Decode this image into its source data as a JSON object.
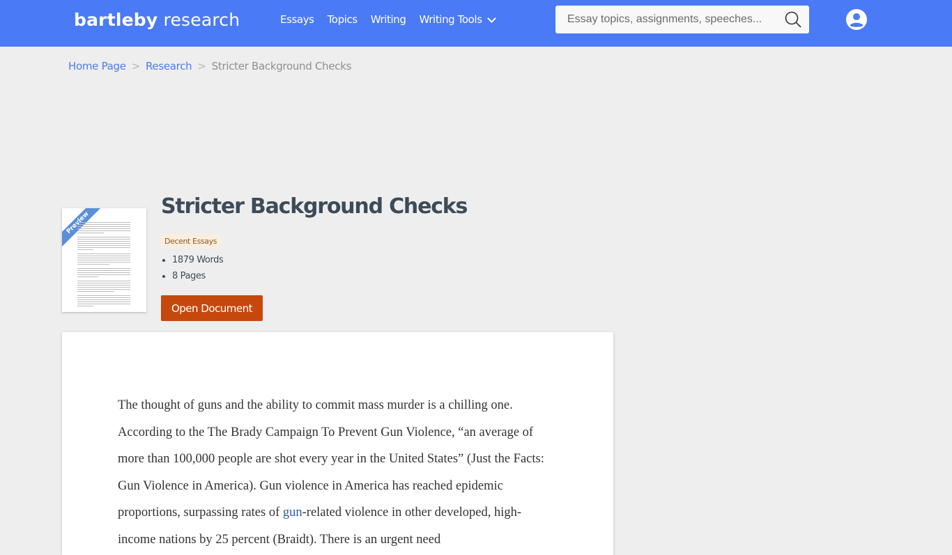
{
  "header": {
    "logo_bold": "bartleby",
    "logo_light": " research",
    "nav": [
      {
        "label": "Essays"
      },
      {
        "label": "Topics"
      },
      {
        "label": "Writing"
      },
      {
        "label": "Writing Tools",
        "has_dropdown": true
      }
    ],
    "search_placeholder": "Essay topics, assignments, speeches...",
    "search_icon": "search-icon",
    "account_icon": "user-circle-icon",
    "accent_color": "#4a7af5"
  },
  "breadcrumb": {
    "items": [
      {
        "label": "Home Page"
      },
      {
        "label": "Research"
      }
    ],
    "separator": ">",
    "current": "Stricter Background Checks"
  },
  "essay": {
    "preview_label": "Preview",
    "title": "Stricter Background Checks",
    "quality_badge": "Decent Essays",
    "words": "1879 Words",
    "pages": "8 Pages",
    "open_button": "Open Document",
    "button_color": "#c5480d"
  },
  "document": {
    "text_before_link": "The thought of guns and the ability to commit mass murder is a chilling one. According to the The Brady Campaign To Prevent Gun Violence, “an average of more than 100,000  people are shot every year in the United States” (Just the Facts: Gun Violence in America). Gun violence in America has reached epidemic proportions, surpassing rates of ",
    "link_text": "gun",
    "text_after_link": "-related violence in other developed, high-income nations by 25 percent (Braidt). There is an urgent need"
  }
}
